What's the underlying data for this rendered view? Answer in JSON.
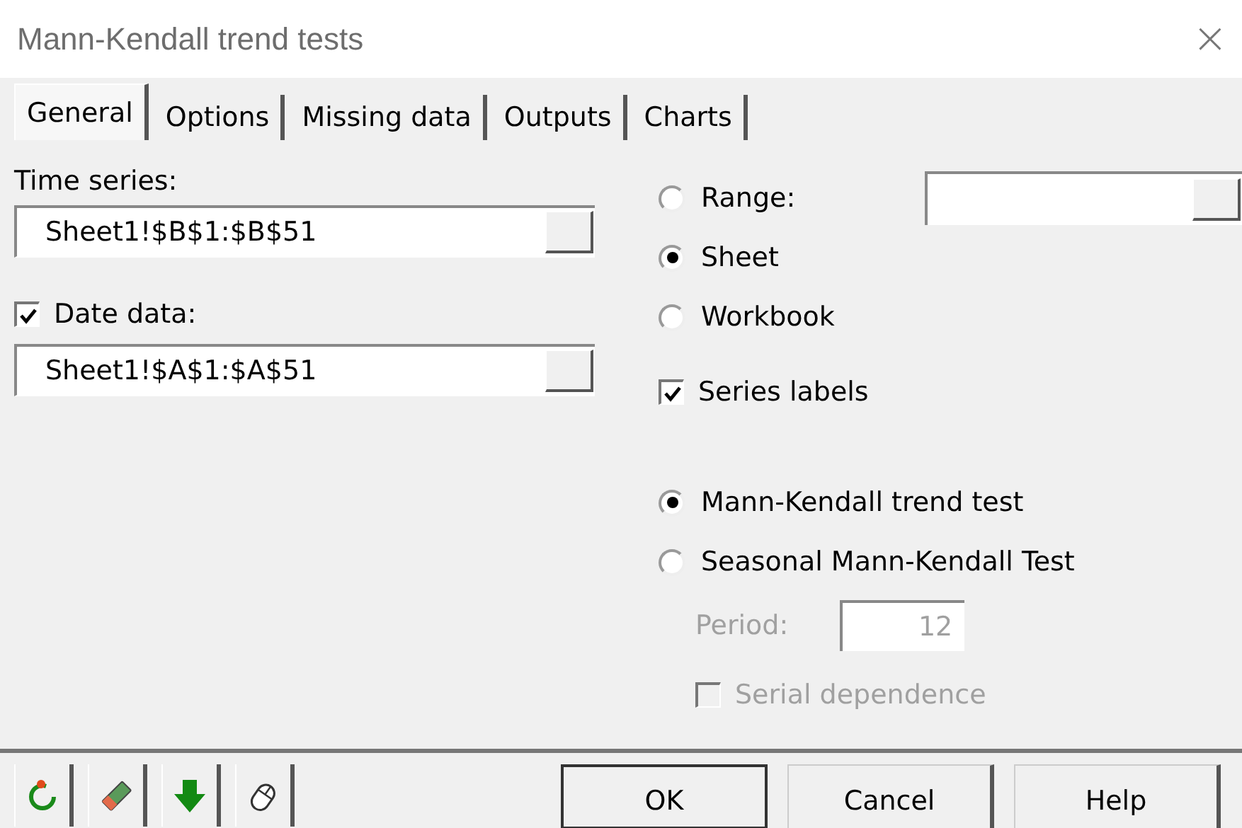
{
  "window": {
    "title": "Mann-Kendall trend tests",
    "close": "×"
  },
  "tabs": [
    {
      "label": "General",
      "selected": true
    },
    {
      "label": "Options",
      "selected": false
    },
    {
      "label": "Missing data",
      "selected": false
    },
    {
      "label": "Outputs",
      "selected": false
    },
    {
      "label": "Charts",
      "selected": false
    }
  ],
  "time_series": {
    "label": "Time series:",
    "value": "Sheet1!$B$1:$B$51"
  },
  "date_data": {
    "label": "Date data:",
    "checked": true,
    "value": "Sheet1!$A$1:$A$51"
  },
  "output_location": [
    {
      "label": "Range:",
      "selected": false
    },
    {
      "label": "Sheet",
      "selected": true
    },
    {
      "label": "Workbook",
      "selected": false
    }
  ],
  "series_labels": {
    "label": "Series labels",
    "checked": true
  },
  "test_type": [
    {
      "label": "Mann-Kendall trend test",
      "selected": true
    },
    {
      "label": "Seasonal Mann-Kendall Test",
      "selected": false
    }
  ],
  "period": {
    "label": "Period:",
    "value": "12",
    "disabled": true
  },
  "serial_dependence": {
    "label": "Serial dependence",
    "checked": false,
    "disabled": true
  },
  "buttons": [
    "OK",
    "Cancel",
    "Help"
  ]
}
